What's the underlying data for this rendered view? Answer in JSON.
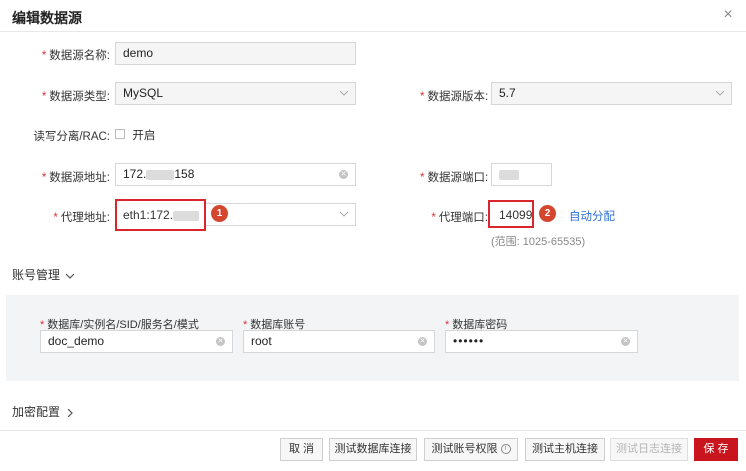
{
  "dialog": {
    "title": "编辑数据源",
    "close_symbol": "×"
  },
  "form": {
    "required_mark": "*",
    "name_label": "数据源名称:",
    "name_value": "demo",
    "type_label": "数据源类型:",
    "type_value": "MySQL",
    "version_label": "数据源版本:",
    "version_value": "5.7",
    "rw_label": "读写分离/RAC:",
    "rw_option": "开启",
    "addr_label": "数据源地址:",
    "addr_prefix": "172.",
    "addr_suffix": "158",
    "port_label": "数据源端口:",
    "proxy_addr_label": "代理地址:",
    "proxy_addr_prefix": "eth1:172.",
    "proxy_port_label": "代理端口:",
    "proxy_port_value": "14099",
    "auto_assign": "自动分配",
    "port_range_hint": "(范围: 1025-65535)"
  },
  "badges": {
    "one": "1",
    "two": "2"
  },
  "account": {
    "section_title": "账号管理",
    "db_label": "数据库/实例名/SID/服务名/模式",
    "db_value": "doc_demo",
    "user_label": "数据库账号",
    "user_value": "root",
    "pwd_label": "数据库密码",
    "pwd_value": "••••••"
  },
  "encryption": {
    "section_title": "加密配置"
  },
  "footer": {
    "cancel": "取 消",
    "test_db": "测试数据库连接",
    "test_perm": "测试账号权限",
    "test_host": "测试主机连接",
    "test_log": "测试日志连接",
    "save": "保 存"
  },
  "colors": {
    "accent_red": "#c9151e",
    "highlight_border": "#d9262c",
    "link_blue": "#2d6fd6",
    "badge_bg": "#d5462f"
  }
}
